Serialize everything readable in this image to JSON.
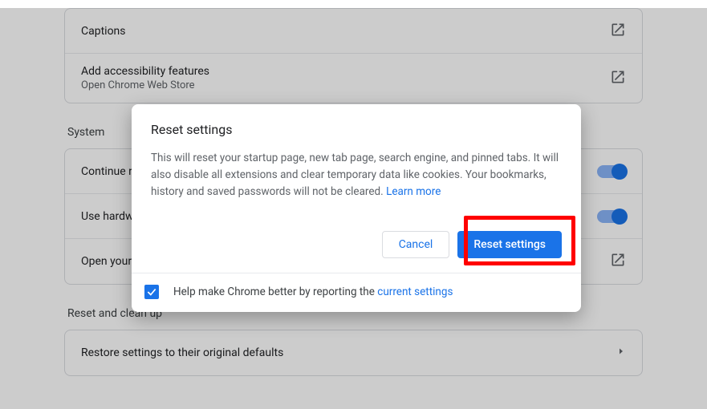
{
  "accessibility_group": {
    "captions": "Captions",
    "addFeatures": "Add accessibility features",
    "addFeaturesSub": "Open Chrome Web Store"
  },
  "systemSection": {
    "title": "System",
    "rows": {
      "continue": "Continue running background apps when Google Chrome is closed",
      "hardware": "Use hardware acceleration when available",
      "proxy": "Open your computer's proxy settings"
    }
  },
  "resetSection": {
    "title": "Reset and clean up",
    "restore": "Restore settings to their original defaults"
  },
  "dialog": {
    "title": "Reset settings",
    "description": "This will reset your startup page, new tab page, search engine, and pinned tabs. It will also disable all extensions and clear temporary data like cookies. Your bookmarks, history and saved passwords will not be cleared. ",
    "learnMore": "Learn more",
    "cancel": "Cancel",
    "confirm": "Reset settings",
    "helpText": "Help make Chrome better by reporting the ",
    "helpLink": "current settings"
  }
}
